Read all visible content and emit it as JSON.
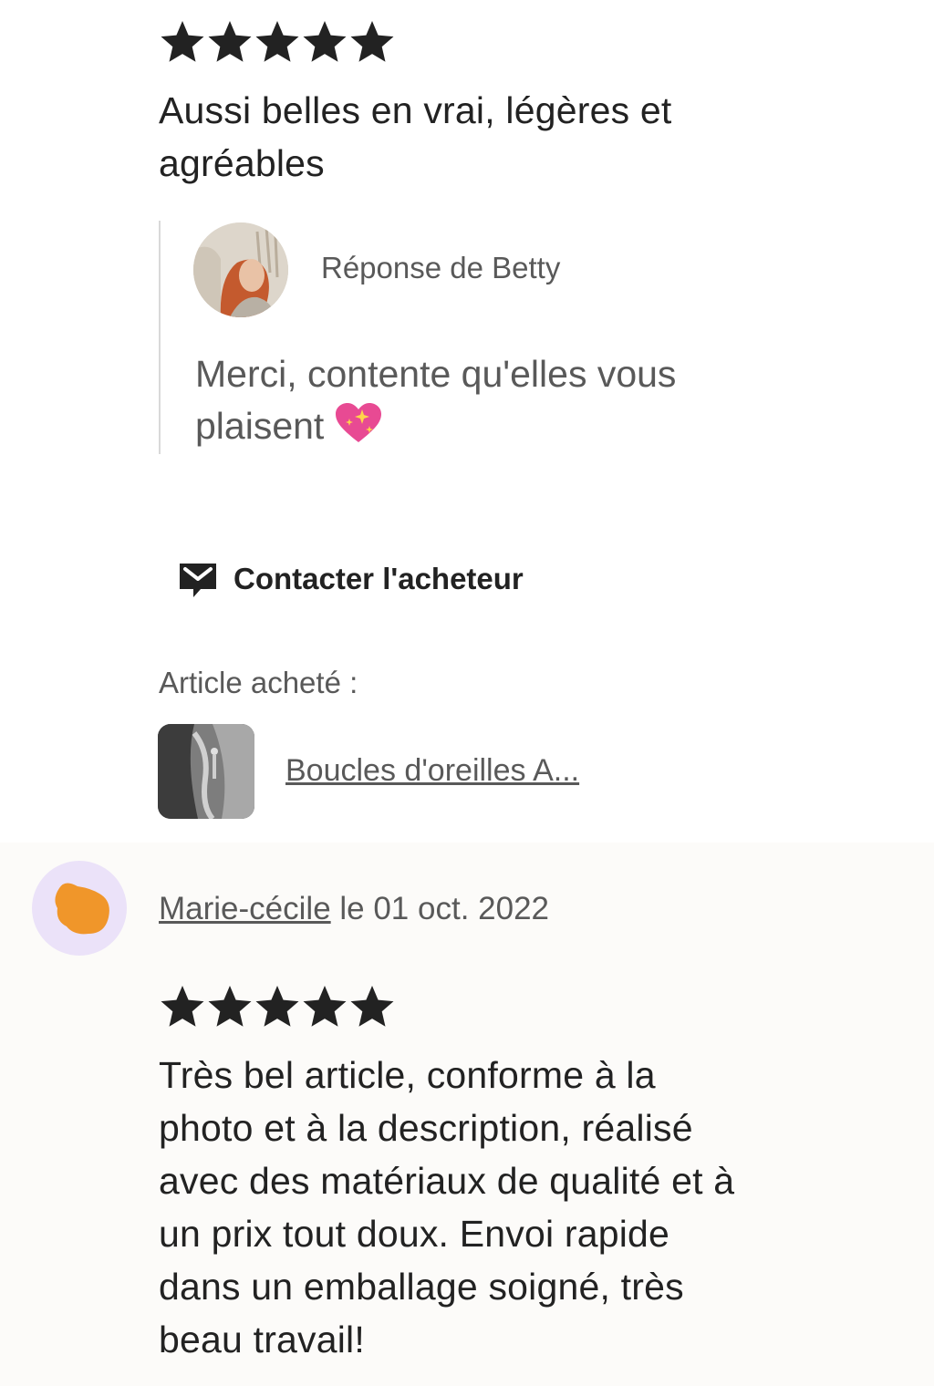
{
  "review_1": {
    "rating": 5,
    "text_line_1": "Aussi belles en vrai, légères et",
    "text_line_2": "agréables",
    "reply": {
      "author_label": "Réponse de Betty",
      "text_line_1": "Merci, contente qu'elles vous",
      "text_line_2": "plaisent",
      "emoji": "sparkling-heart-icon"
    },
    "contact_label": "Contacter l'acheteur",
    "purchased_label": "Article acheté :",
    "product_link": "Boucles d'oreilles A..."
  },
  "review_2": {
    "reviewer_name": "Marie-cécile",
    "date_text": " le 01 oct. 2022",
    "rating": 5,
    "text_lines": [
      "Très bel article, conforme à la",
      "photo et à la description, réalisé",
      "avec des matériaux de qualité et à",
      "un prix tout doux. Envoi rapide",
      "dans un emballage soigné, très",
      "beau travail!"
    ]
  },
  "colors": {
    "text_primary": "#222222",
    "text_secondary": "#595959",
    "star": "#222222",
    "reviewer_avatar_bg": "#ebe2f9",
    "reviewer_avatar_blob": "#f0962a",
    "heart": "#e84a93"
  }
}
